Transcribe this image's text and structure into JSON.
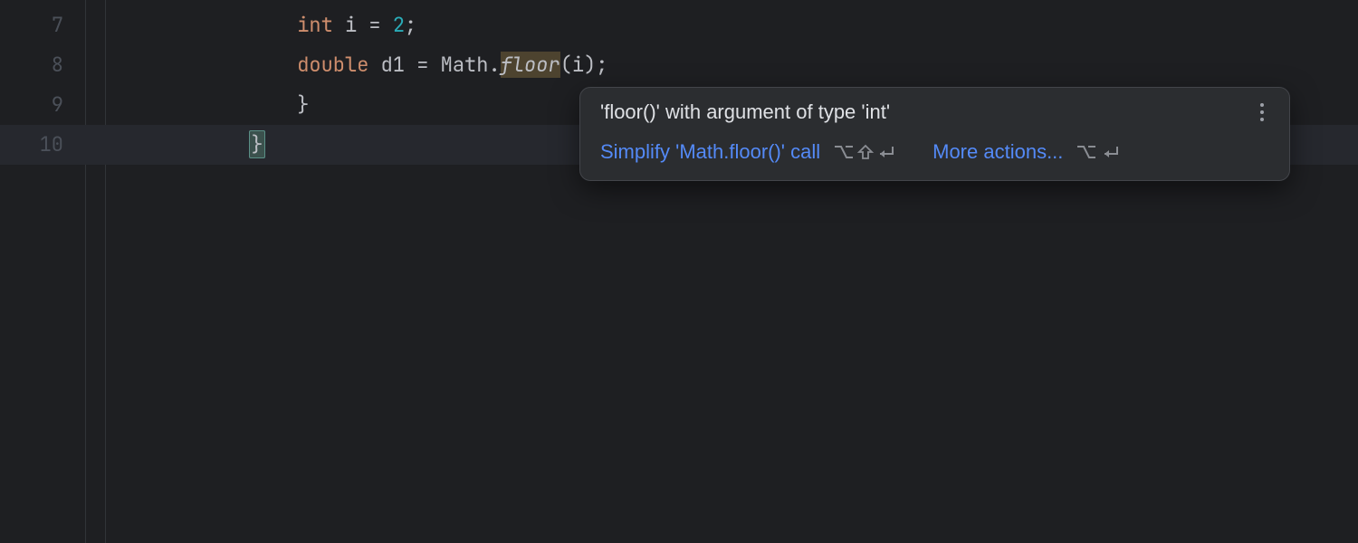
{
  "gutter": {
    "lines": [
      "7",
      "8",
      "9",
      "10"
    ]
  },
  "code": {
    "line7": {
      "indent": "                ",
      "kw": "int",
      "sp1": " ",
      "ident": "i",
      "sp2": " ",
      "eq": "=",
      "sp3": " ",
      "num": "2",
      "semi": ";"
    },
    "line8": {
      "indent": "                ",
      "kw": "double",
      "sp1": " ",
      "ident": "d1",
      "sp2": " ",
      "eq": "=",
      "sp3": " ",
      "cls": "Math",
      "dot": ".",
      "method": "floor",
      "open": "(",
      "arg": "i",
      "close": ")",
      "semi": ";"
    },
    "line9": {
      "indent": "                ",
      "brace": "}"
    },
    "line10": {
      "indent": "            ",
      "brace": "}"
    }
  },
  "popup": {
    "title": "'floor()' with argument of type 'int'",
    "simplify_label": "Simplify 'Math.floor()' call",
    "more_label": "More actions..."
  }
}
